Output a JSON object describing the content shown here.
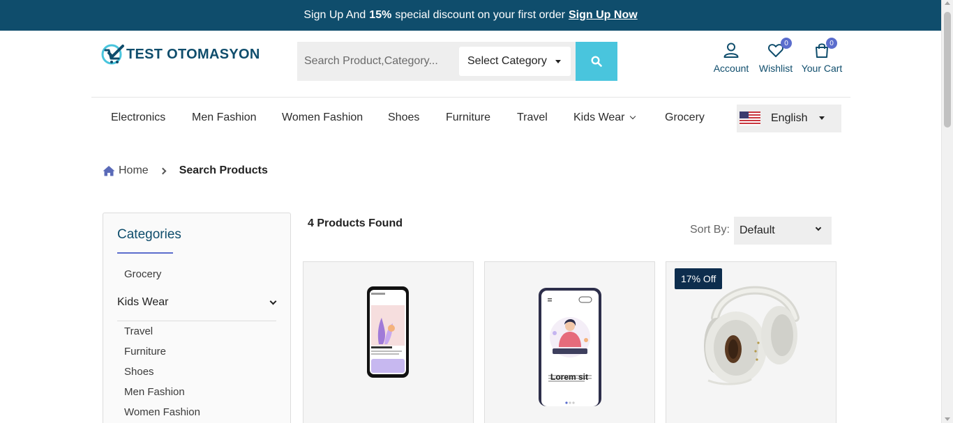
{
  "promo": {
    "prefix": "Sign Up And",
    "discount": "15%",
    "suffix": "special discount on your first order",
    "link": "Sign Up Now"
  },
  "logo": {
    "text": "TEST OTOMASYON"
  },
  "search": {
    "placeholder": "Search Product,Category...",
    "category_label": "Select Category"
  },
  "header_icons": {
    "account": "Account",
    "wishlist": "Wishlist",
    "wishlist_count": "0",
    "cart": "Your Cart",
    "cart_count": "0"
  },
  "nav": {
    "items": [
      "Electronics",
      "Men Fashion",
      "Women Fashion",
      "Shoes",
      "Furniture",
      "Travel",
      "Kids Wear",
      "Grocery"
    ]
  },
  "language": {
    "label": "English"
  },
  "breadcrumb": {
    "home": "Home",
    "current": "Search Products"
  },
  "sidebar": {
    "title": "Categories",
    "items": [
      "Grocery",
      "Kids Wear",
      "Travel",
      "Furniture",
      "Shoes",
      "Men Fashion",
      "Women Fashion"
    ]
  },
  "results": {
    "found": "4 Products Found",
    "sort_label": "Sort By:",
    "sort_value": "Default"
  },
  "products": [
    {
      "badge": ""
    },
    {
      "badge": "",
      "screen_text": "Lorem sit"
    },
    {
      "badge": "17% Off"
    }
  ],
  "colors": {
    "brand": "#0f4d6c",
    "accent": "#49c5dd",
    "badge": "#5b6dcd"
  }
}
